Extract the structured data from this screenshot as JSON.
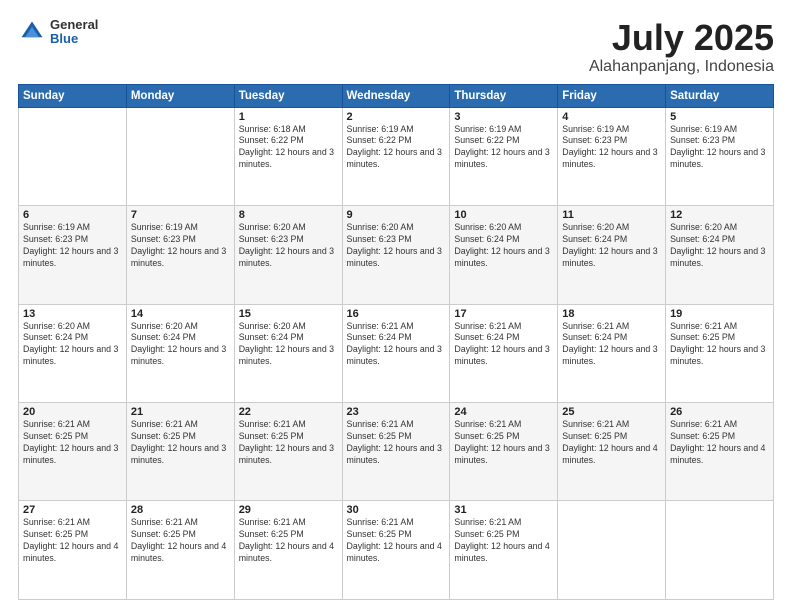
{
  "logo": {
    "general": "General",
    "blue": "Blue"
  },
  "title": "July 2025",
  "subtitle": "Alahanpanjang, Indonesia",
  "days_header": [
    "Sunday",
    "Monday",
    "Tuesday",
    "Wednesday",
    "Thursday",
    "Friday",
    "Saturday"
  ],
  "weeks": [
    [
      {
        "day": "",
        "info": ""
      },
      {
        "day": "",
        "info": ""
      },
      {
        "day": "1",
        "info": "Sunrise: 6:18 AM\nSunset: 6:22 PM\nDaylight: 12 hours\nand 3 minutes."
      },
      {
        "day": "2",
        "info": "Sunrise: 6:19 AM\nSunset: 6:22 PM\nDaylight: 12 hours\nand 3 minutes."
      },
      {
        "day": "3",
        "info": "Sunrise: 6:19 AM\nSunset: 6:22 PM\nDaylight: 12 hours\nand 3 minutes."
      },
      {
        "day": "4",
        "info": "Sunrise: 6:19 AM\nSunset: 6:23 PM\nDaylight: 12 hours\nand 3 minutes."
      },
      {
        "day": "5",
        "info": "Sunrise: 6:19 AM\nSunset: 6:23 PM\nDaylight: 12 hours\nand 3 minutes."
      }
    ],
    [
      {
        "day": "6",
        "info": "Sunrise: 6:19 AM\nSunset: 6:23 PM\nDaylight: 12 hours\nand 3 minutes."
      },
      {
        "day": "7",
        "info": "Sunrise: 6:19 AM\nSunset: 6:23 PM\nDaylight: 12 hours\nand 3 minutes."
      },
      {
        "day": "8",
        "info": "Sunrise: 6:20 AM\nSunset: 6:23 PM\nDaylight: 12 hours\nand 3 minutes."
      },
      {
        "day": "9",
        "info": "Sunrise: 6:20 AM\nSunset: 6:23 PM\nDaylight: 12 hours\nand 3 minutes."
      },
      {
        "day": "10",
        "info": "Sunrise: 6:20 AM\nSunset: 6:24 PM\nDaylight: 12 hours\nand 3 minutes."
      },
      {
        "day": "11",
        "info": "Sunrise: 6:20 AM\nSunset: 6:24 PM\nDaylight: 12 hours\nand 3 minutes."
      },
      {
        "day": "12",
        "info": "Sunrise: 6:20 AM\nSunset: 6:24 PM\nDaylight: 12 hours\nand 3 minutes."
      }
    ],
    [
      {
        "day": "13",
        "info": "Sunrise: 6:20 AM\nSunset: 6:24 PM\nDaylight: 12 hours\nand 3 minutes."
      },
      {
        "day": "14",
        "info": "Sunrise: 6:20 AM\nSunset: 6:24 PM\nDaylight: 12 hours\nand 3 minutes."
      },
      {
        "day": "15",
        "info": "Sunrise: 6:20 AM\nSunset: 6:24 PM\nDaylight: 12 hours\nand 3 minutes."
      },
      {
        "day": "16",
        "info": "Sunrise: 6:21 AM\nSunset: 6:24 PM\nDaylight: 12 hours\nand 3 minutes."
      },
      {
        "day": "17",
        "info": "Sunrise: 6:21 AM\nSunset: 6:24 PM\nDaylight: 12 hours\nand 3 minutes."
      },
      {
        "day": "18",
        "info": "Sunrise: 6:21 AM\nSunset: 6:24 PM\nDaylight: 12 hours\nand 3 minutes."
      },
      {
        "day": "19",
        "info": "Sunrise: 6:21 AM\nSunset: 6:25 PM\nDaylight: 12 hours\nand 3 minutes."
      }
    ],
    [
      {
        "day": "20",
        "info": "Sunrise: 6:21 AM\nSunset: 6:25 PM\nDaylight: 12 hours\nand 3 minutes."
      },
      {
        "day": "21",
        "info": "Sunrise: 6:21 AM\nSunset: 6:25 PM\nDaylight: 12 hours\nand 3 minutes."
      },
      {
        "day": "22",
        "info": "Sunrise: 6:21 AM\nSunset: 6:25 PM\nDaylight: 12 hours\nand 3 minutes."
      },
      {
        "day": "23",
        "info": "Sunrise: 6:21 AM\nSunset: 6:25 PM\nDaylight: 12 hours\nand 3 minutes."
      },
      {
        "day": "24",
        "info": "Sunrise: 6:21 AM\nSunset: 6:25 PM\nDaylight: 12 hours\nand 3 minutes."
      },
      {
        "day": "25",
        "info": "Sunrise: 6:21 AM\nSunset: 6:25 PM\nDaylight: 12 hours\nand 4 minutes."
      },
      {
        "day": "26",
        "info": "Sunrise: 6:21 AM\nSunset: 6:25 PM\nDaylight: 12 hours\nand 4 minutes."
      }
    ],
    [
      {
        "day": "27",
        "info": "Sunrise: 6:21 AM\nSunset: 6:25 PM\nDaylight: 12 hours\nand 4 minutes."
      },
      {
        "day": "28",
        "info": "Sunrise: 6:21 AM\nSunset: 6:25 PM\nDaylight: 12 hours\nand 4 minutes."
      },
      {
        "day": "29",
        "info": "Sunrise: 6:21 AM\nSunset: 6:25 PM\nDaylight: 12 hours\nand 4 minutes."
      },
      {
        "day": "30",
        "info": "Sunrise: 6:21 AM\nSunset: 6:25 PM\nDaylight: 12 hours\nand 4 minutes."
      },
      {
        "day": "31",
        "info": "Sunrise: 6:21 AM\nSunset: 6:25 PM\nDaylight: 12 hours\nand 4 minutes."
      },
      {
        "day": "",
        "info": ""
      },
      {
        "day": "",
        "info": ""
      }
    ]
  ]
}
